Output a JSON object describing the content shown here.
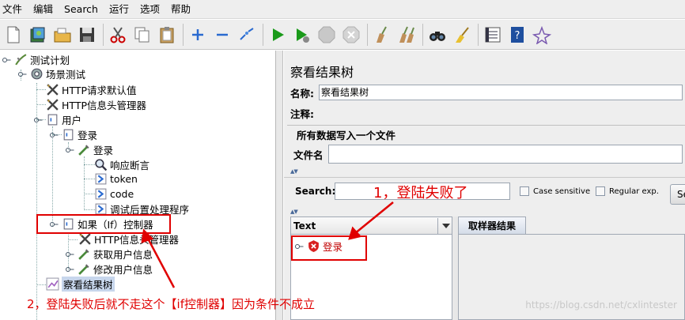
{
  "menu": [
    "文件",
    "编辑",
    "Search",
    "运行",
    "选项",
    "帮助"
  ],
  "toolbar": [
    "new-icon",
    "templates-icon",
    "open-icon",
    "save-icon",
    "cut-icon",
    "copy-icon",
    "paste-icon",
    "expand-icon",
    "collapse-icon",
    "toggle-icon",
    "start-icon",
    "start-no-pause-icon",
    "stop-icon",
    "shutdown-icon",
    "clear-icon",
    "clear-all-icon",
    "search-binoculars-icon",
    "reset-search-icon",
    "function-helper-icon",
    "help-icon",
    "remote-icon"
  ],
  "tree": {
    "plan": "测试计划",
    "thread_group": "场景测试",
    "http_defaults": "HTTP请求默认值",
    "header_manager": "HTTP信息头管理器",
    "user": "用户",
    "login_controller": "登录",
    "login_sampler": "登录",
    "response_assertion": "响应断言",
    "token": "token",
    "code": "code",
    "debug_post": "调试后置处理程序",
    "if_controller": "如果（If）控制器",
    "if_header": "HTTP信息头管理器",
    "get_user": "获取用户信息",
    "modify_user": "修改用户信息",
    "view_tree": "察看结果树"
  },
  "panel": {
    "title": "察看结果树",
    "name_label": "名称:",
    "name_value": "察看结果树",
    "comment_label": "注释:",
    "fieldset_title": "所有数据写入一个文件",
    "filename_label": "文件名",
    "search_label": "Search:",
    "case_sensitive": "Case sensitive",
    "regex": "Regular exp.",
    "search_button": "Se",
    "renderer": "Text",
    "result_item": "登录",
    "tab_sampler": "取样器结果"
  },
  "annotations": {
    "note1": "1，登陆失败了",
    "note2": "2，登陆失败后就不走这个【if控制器】因为条件不成立"
  },
  "watermark": "https://blog.csdn.net/cxlintester",
  "colors": {
    "annotation": "#e00000",
    "selection": "#c7d6ec",
    "background": "#eeeeee"
  }
}
